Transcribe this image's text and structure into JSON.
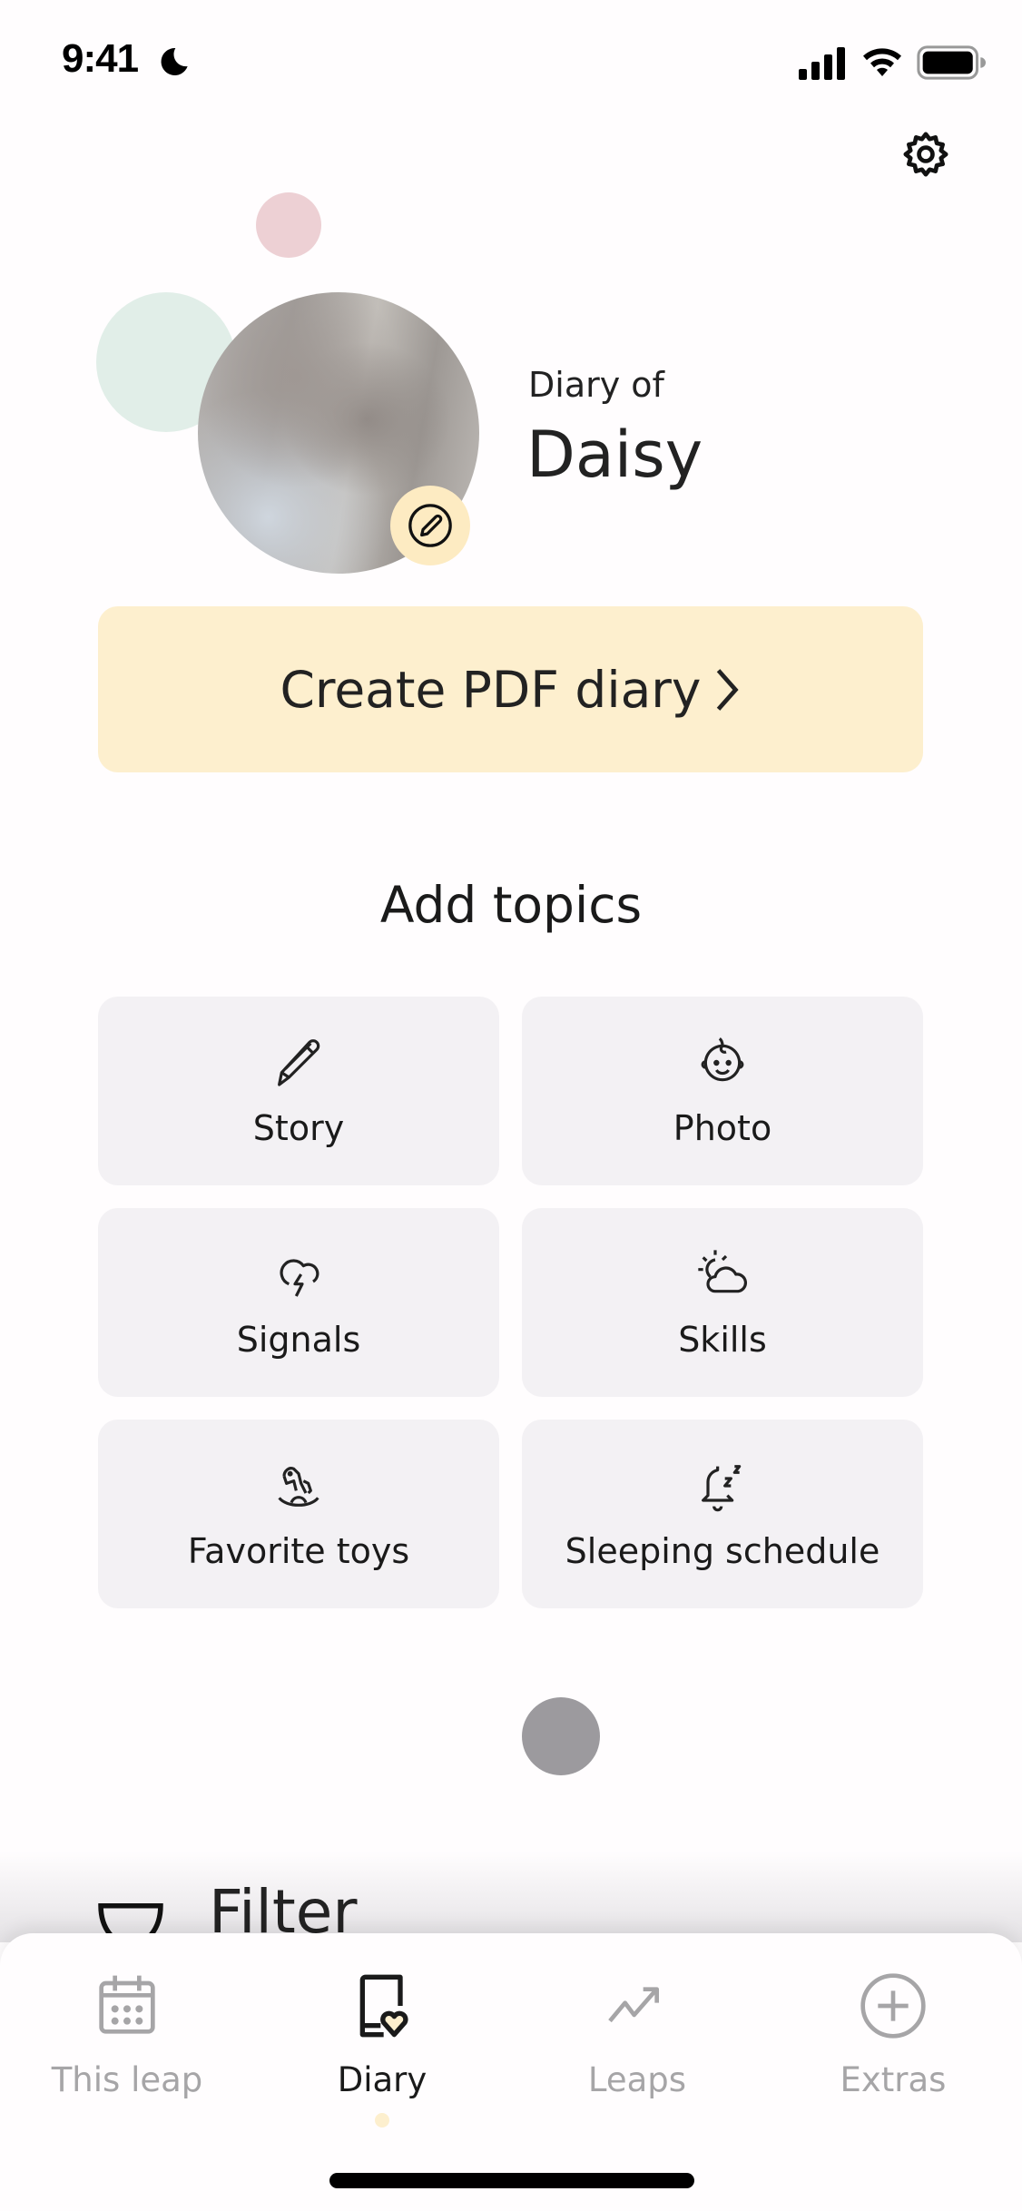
{
  "status_bar": {
    "time": "9:41",
    "focus_icon": "moon-icon",
    "signal_icon": "cellular-signal-icon",
    "wifi_icon": "wifi-icon",
    "battery_icon": "battery-icon"
  },
  "header": {
    "settings_icon": "gear-icon"
  },
  "profile": {
    "diary_of_label": "Diary of",
    "child_name": "Daisy",
    "avatar": "child-photo",
    "edit_icon": "pencil-circle-icon",
    "colors": {
      "pink_deco": "#edd0d4",
      "green_deco": "#e1eee8",
      "badge": "#fdebc2"
    }
  },
  "pdf_button": {
    "label": "Create PDF diary",
    "icon": "chevron-right-icon",
    "color": "#fdefce"
  },
  "topics": {
    "title": "Add topics",
    "items": [
      {
        "label": "Story",
        "icon": "pencil-icon"
      },
      {
        "label": "Photo",
        "icon": "baby-face-icon"
      },
      {
        "label": "Signals",
        "icon": "storm-cloud-icon"
      },
      {
        "label": "Skills",
        "icon": "sun-cloud-icon"
      },
      {
        "label": "Favorite toys",
        "icon": "rocking-horse-icon"
      },
      {
        "label": "Sleeping schedule",
        "icon": "bell-sleep-icon"
      }
    ]
  },
  "filter": {
    "label": "Filter",
    "icon": "filter-icon"
  },
  "tabbar": {
    "active": "Diary",
    "items": [
      {
        "label": "This leap",
        "icon": "calendar-icon"
      },
      {
        "label": "Diary",
        "icon": "diary-heart-icon"
      },
      {
        "label": "Leaps",
        "icon": "trend-up-icon"
      },
      {
        "label": "Extras",
        "icon": "plus-circle-icon"
      }
    ]
  }
}
